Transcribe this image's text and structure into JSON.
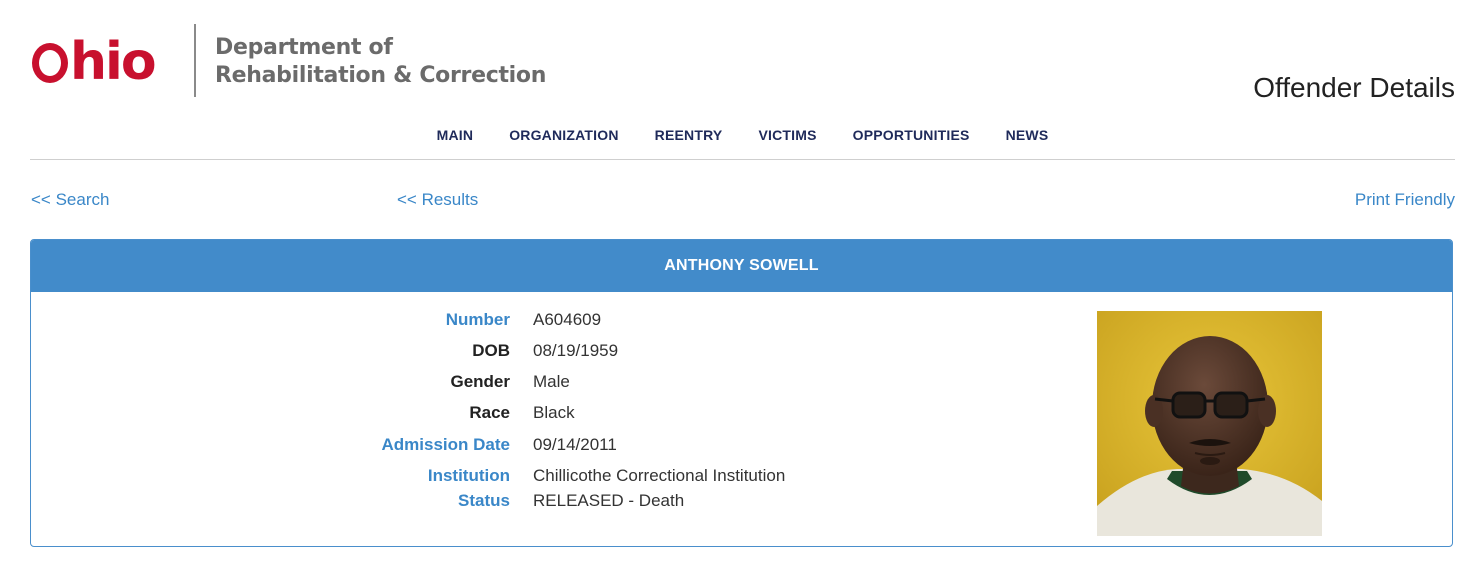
{
  "header": {
    "logo_word": "Ohio",
    "logo_word_rest": "hio",
    "dept_line1": "Department of",
    "dept_line2": "Rehabilitation & Correction",
    "page_title": "Offender Details"
  },
  "nav": {
    "items": [
      {
        "label": "MAIN"
      },
      {
        "label": "ORGANIZATION"
      },
      {
        "label": "REENTRY"
      },
      {
        "label": "VICTIMS"
      },
      {
        "label": "OPPORTUNITIES"
      },
      {
        "label": "NEWS"
      }
    ]
  },
  "links": {
    "search": "<< Search",
    "results": "<< Results",
    "print": "Print Friendly"
  },
  "offender": {
    "name": "ANTHONY SOWELL",
    "fields": [
      {
        "label": "Number",
        "value": "A604609",
        "label_color": "blue"
      },
      {
        "label": "DOB",
        "value": "08/19/1959",
        "label_color": "dark"
      },
      {
        "label": "Gender",
        "value": "Male",
        "label_color": "dark"
      },
      {
        "label": "Race",
        "value": "Black",
        "label_color": "dark"
      },
      {
        "label": "Admission Date",
        "value": "09/14/2011",
        "label_color": "blue"
      },
      {
        "label": "Institution",
        "value": "Chillicothe Correctional Institution",
        "label_color": "blue"
      },
      {
        "label": "Status",
        "value": "RELEASED - Death",
        "label_color": "blue"
      }
    ]
  },
  "colors": {
    "brand_red": "#c8102e",
    "panel_blue": "#428bca",
    "link_blue": "#3a87c8",
    "nav_navy": "#1f2a5a"
  }
}
